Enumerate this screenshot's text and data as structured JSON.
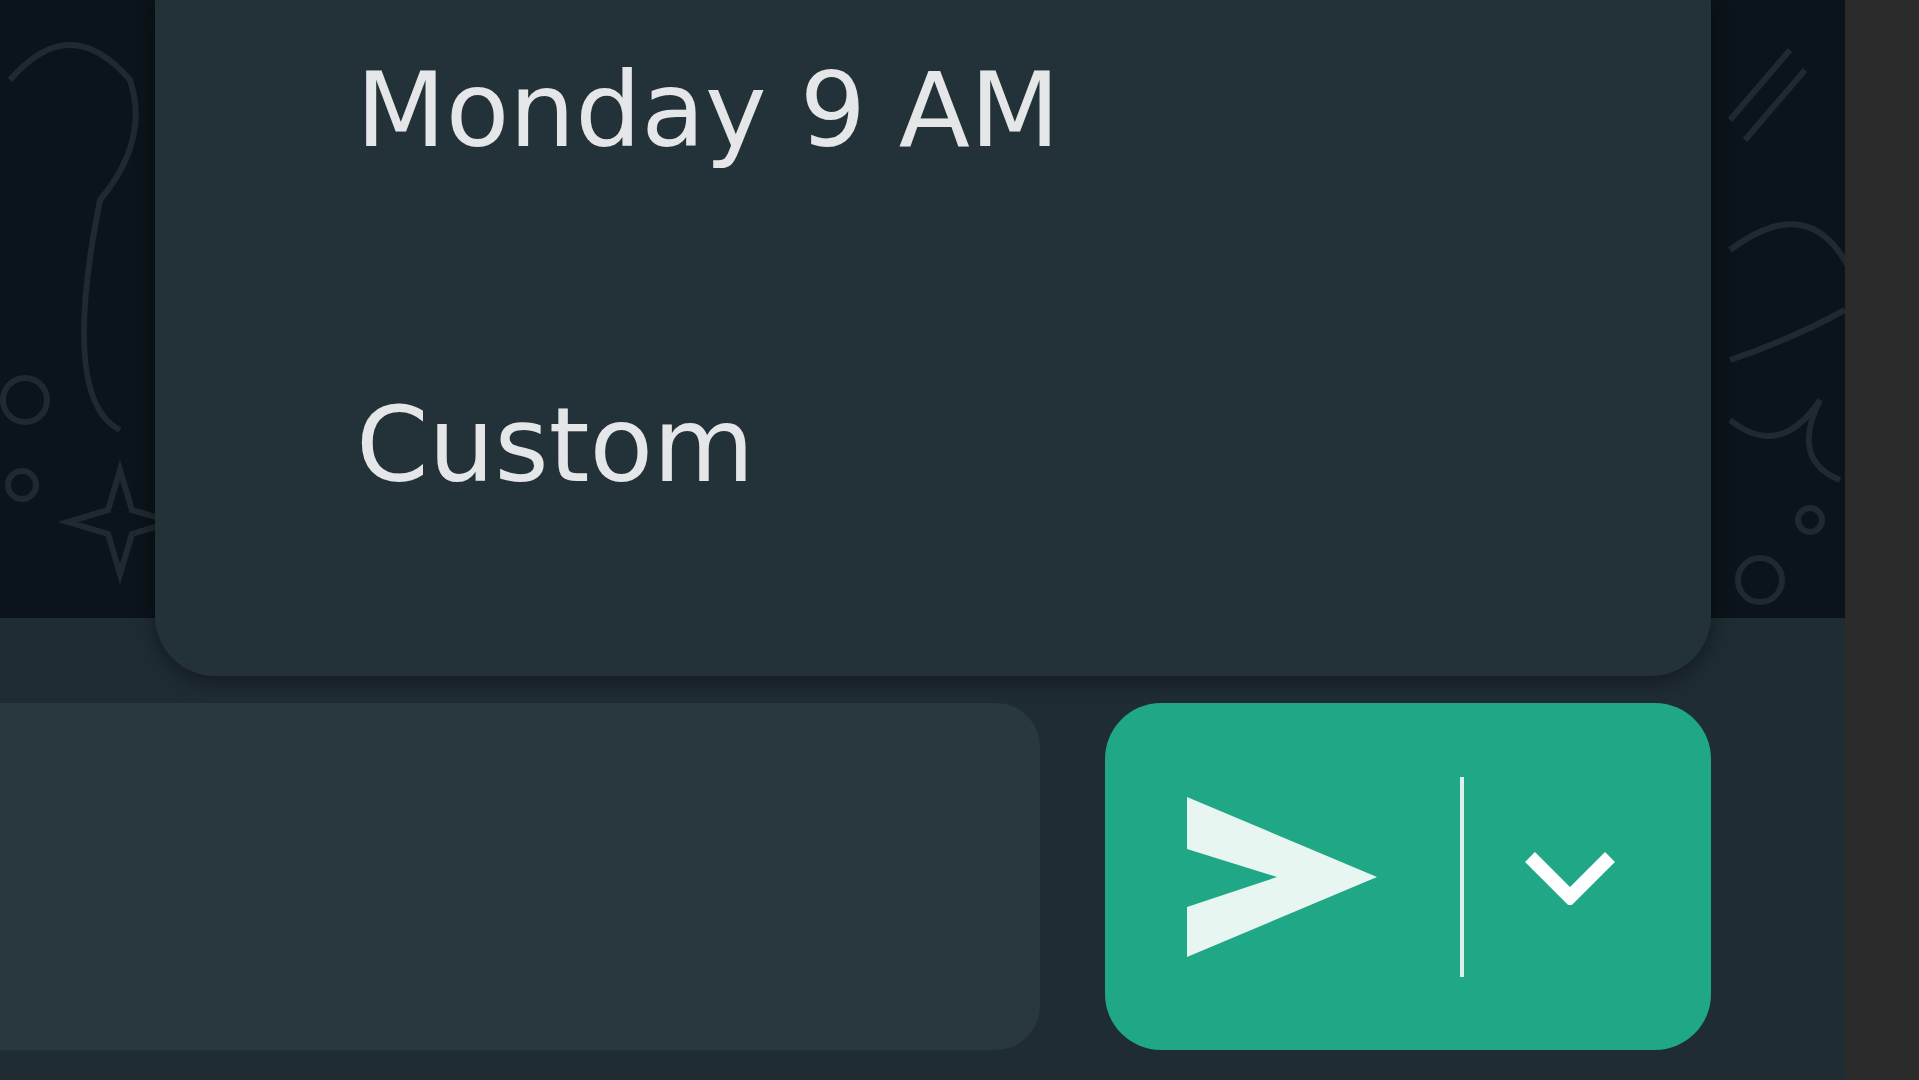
{
  "schedule_menu": {
    "items": [
      {
        "label": "Monday 9 AM"
      },
      {
        "label": "Custom"
      }
    ]
  },
  "composer": {
    "send_button": {
      "has_options": true
    }
  }
}
